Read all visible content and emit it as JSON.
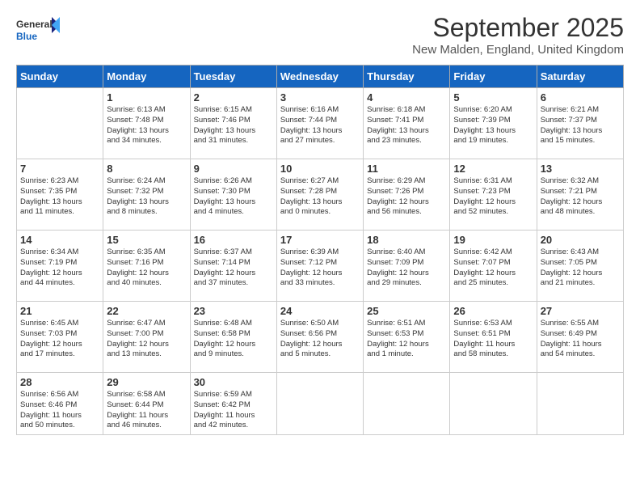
{
  "header": {
    "logo_general": "General",
    "logo_blue": "Blue",
    "month_title": "September 2025",
    "location": "New Malden, England, United Kingdom"
  },
  "days_of_week": [
    "Sunday",
    "Monday",
    "Tuesday",
    "Wednesday",
    "Thursday",
    "Friday",
    "Saturday"
  ],
  "weeks": [
    [
      {
        "day": "",
        "content": ""
      },
      {
        "day": "1",
        "content": "Sunrise: 6:13 AM\nSunset: 7:48 PM\nDaylight: 13 hours\nand 34 minutes."
      },
      {
        "day": "2",
        "content": "Sunrise: 6:15 AM\nSunset: 7:46 PM\nDaylight: 13 hours\nand 31 minutes."
      },
      {
        "day": "3",
        "content": "Sunrise: 6:16 AM\nSunset: 7:44 PM\nDaylight: 13 hours\nand 27 minutes."
      },
      {
        "day": "4",
        "content": "Sunrise: 6:18 AM\nSunset: 7:41 PM\nDaylight: 13 hours\nand 23 minutes."
      },
      {
        "day": "5",
        "content": "Sunrise: 6:20 AM\nSunset: 7:39 PM\nDaylight: 13 hours\nand 19 minutes."
      },
      {
        "day": "6",
        "content": "Sunrise: 6:21 AM\nSunset: 7:37 PM\nDaylight: 13 hours\nand 15 minutes."
      }
    ],
    [
      {
        "day": "7",
        "content": "Sunrise: 6:23 AM\nSunset: 7:35 PM\nDaylight: 13 hours\nand 11 minutes."
      },
      {
        "day": "8",
        "content": "Sunrise: 6:24 AM\nSunset: 7:32 PM\nDaylight: 13 hours\nand 8 minutes."
      },
      {
        "day": "9",
        "content": "Sunrise: 6:26 AM\nSunset: 7:30 PM\nDaylight: 13 hours\nand 4 minutes."
      },
      {
        "day": "10",
        "content": "Sunrise: 6:27 AM\nSunset: 7:28 PM\nDaylight: 13 hours\nand 0 minutes."
      },
      {
        "day": "11",
        "content": "Sunrise: 6:29 AM\nSunset: 7:26 PM\nDaylight: 12 hours\nand 56 minutes."
      },
      {
        "day": "12",
        "content": "Sunrise: 6:31 AM\nSunset: 7:23 PM\nDaylight: 12 hours\nand 52 minutes."
      },
      {
        "day": "13",
        "content": "Sunrise: 6:32 AM\nSunset: 7:21 PM\nDaylight: 12 hours\nand 48 minutes."
      }
    ],
    [
      {
        "day": "14",
        "content": "Sunrise: 6:34 AM\nSunset: 7:19 PM\nDaylight: 12 hours\nand 44 minutes."
      },
      {
        "day": "15",
        "content": "Sunrise: 6:35 AM\nSunset: 7:16 PM\nDaylight: 12 hours\nand 40 minutes."
      },
      {
        "day": "16",
        "content": "Sunrise: 6:37 AM\nSunset: 7:14 PM\nDaylight: 12 hours\nand 37 minutes."
      },
      {
        "day": "17",
        "content": "Sunrise: 6:39 AM\nSunset: 7:12 PM\nDaylight: 12 hours\nand 33 minutes."
      },
      {
        "day": "18",
        "content": "Sunrise: 6:40 AM\nSunset: 7:09 PM\nDaylight: 12 hours\nand 29 minutes."
      },
      {
        "day": "19",
        "content": "Sunrise: 6:42 AM\nSunset: 7:07 PM\nDaylight: 12 hours\nand 25 minutes."
      },
      {
        "day": "20",
        "content": "Sunrise: 6:43 AM\nSunset: 7:05 PM\nDaylight: 12 hours\nand 21 minutes."
      }
    ],
    [
      {
        "day": "21",
        "content": "Sunrise: 6:45 AM\nSunset: 7:03 PM\nDaylight: 12 hours\nand 17 minutes."
      },
      {
        "day": "22",
        "content": "Sunrise: 6:47 AM\nSunset: 7:00 PM\nDaylight: 12 hours\nand 13 minutes."
      },
      {
        "day": "23",
        "content": "Sunrise: 6:48 AM\nSunset: 6:58 PM\nDaylight: 12 hours\nand 9 minutes."
      },
      {
        "day": "24",
        "content": "Sunrise: 6:50 AM\nSunset: 6:56 PM\nDaylight: 12 hours\nand 5 minutes."
      },
      {
        "day": "25",
        "content": "Sunrise: 6:51 AM\nSunset: 6:53 PM\nDaylight: 12 hours\nand 1 minute."
      },
      {
        "day": "26",
        "content": "Sunrise: 6:53 AM\nSunset: 6:51 PM\nDaylight: 11 hours\nand 58 minutes."
      },
      {
        "day": "27",
        "content": "Sunrise: 6:55 AM\nSunset: 6:49 PM\nDaylight: 11 hours\nand 54 minutes."
      }
    ],
    [
      {
        "day": "28",
        "content": "Sunrise: 6:56 AM\nSunset: 6:46 PM\nDaylight: 11 hours\nand 50 minutes."
      },
      {
        "day": "29",
        "content": "Sunrise: 6:58 AM\nSunset: 6:44 PM\nDaylight: 11 hours\nand 46 minutes."
      },
      {
        "day": "30",
        "content": "Sunrise: 6:59 AM\nSunset: 6:42 PM\nDaylight: 11 hours\nand 42 minutes."
      },
      {
        "day": "",
        "content": ""
      },
      {
        "day": "",
        "content": ""
      },
      {
        "day": "",
        "content": ""
      },
      {
        "day": "",
        "content": ""
      }
    ]
  ]
}
